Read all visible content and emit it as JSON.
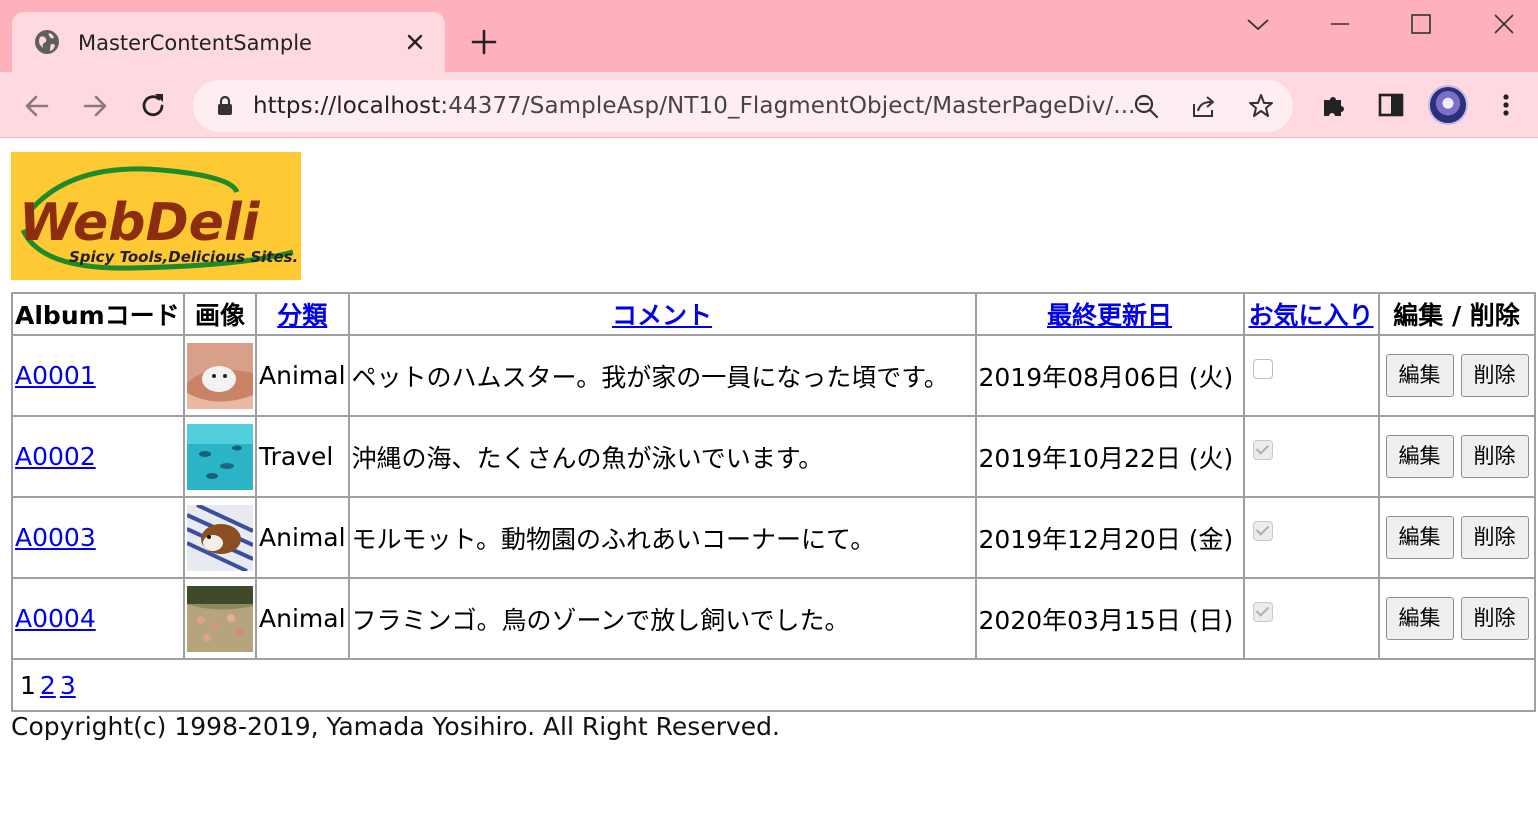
{
  "browser": {
    "tab_title": "MasterContentSample",
    "url_host": "https://localhost",
    "url_rest": ":44377/SampleAsp/NT10_FlagmentObject/MasterPageDiv/..."
  },
  "logo": {
    "brand": "WebDeli",
    "tagline": "Spicy Tools,Delicious Sites."
  },
  "table": {
    "headers": {
      "code": "Albumコード",
      "image": "画像",
      "category": "分類",
      "comment": "コメント",
      "updated": "最終更新日",
      "favorite": "お気に入り",
      "actions": "編集 / 削除"
    },
    "rows": [
      {
        "code": "A0001",
        "category": "Animal",
        "comment": "ペットのハムスター。我が家の一員になった頃です。",
        "updated": "2019年08月06日 (火)",
        "favorite": false,
        "edit": "編集",
        "delete": "削除",
        "image": "hamster"
      },
      {
        "code": "A0002",
        "category": "Travel",
        "comment": "沖縄の海、たくさんの魚が泳いでいます。",
        "updated": "2019年10月22日 (火)",
        "favorite": true,
        "edit": "編集",
        "delete": "削除",
        "image": "sea-fish"
      },
      {
        "code": "A0003",
        "category": "Animal",
        "comment": "モルモット。動物園のふれあいコーナーにて。",
        "updated": "2019年12月20日 (金)",
        "favorite": true,
        "edit": "編集",
        "delete": "削除",
        "image": "guinea-pig"
      },
      {
        "code": "A0004",
        "category": "Animal",
        "comment": "フラミンゴ。鳥のゾーンで放し飼いでした。",
        "updated": "2020年03月15日 (日)",
        "favorite": true,
        "edit": "編集",
        "delete": "削除",
        "image": "flamingo"
      }
    ],
    "pager": {
      "current": "1",
      "links": [
        "2",
        "3"
      ]
    }
  },
  "footer": {
    "copyright": "Copyright(c) 1998-2019, Yamada Yosihiro. All Right Reserved."
  },
  "colors": {
    "tabstrip": "#ffb0bd",
    "toolbar": "#ffd9e0",
    "logo_bg": "#ffc933",
    "link": "#0000ee"
  }
}
